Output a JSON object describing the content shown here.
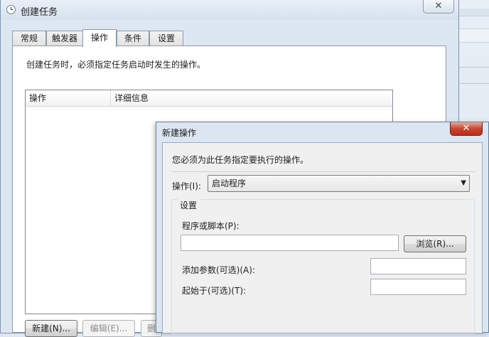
{
  "main_window": {
    "title": "创建任务",
    "close_glyph": "✕",
    "tabs": [
      "常规",
      "触发器",
      "操作",
      "条件",
      "设置"
    ],
    "active_tab": "操作",
    "description": "创建任务时，必须指定任务启动时发生的操作。",
    "list_columns": [
      "操作",
      "详细信息"
    ],
    "buttons": {
      "new": "新建(N)...",
      "edit": "编辑(E)...",
      "delete": "删"
    }
  },
  "dialog": {
    "title": "新建操作",
    "close_glyph": "✕",
    "description": "您必须为此任务指定要执行的操作。",
    "action_label": "操作(I):",
    "action_value": "启动程序",
    "settings_group_label": "设置",
    "program_label": "程序或脚本(P):",
    "program_value": "",
    "browse_button": "浏览(R)...",
    "args_label": "添加参数(可选)(A):",
    "args_value": "",
    "start_in_label": "起始于(可选)(T):",
    "start_in_value": ""
  },
  "icons": [
    "clock-icon",
    "close-icon",
    "dropdown-arrow-icon"
  ]
}
